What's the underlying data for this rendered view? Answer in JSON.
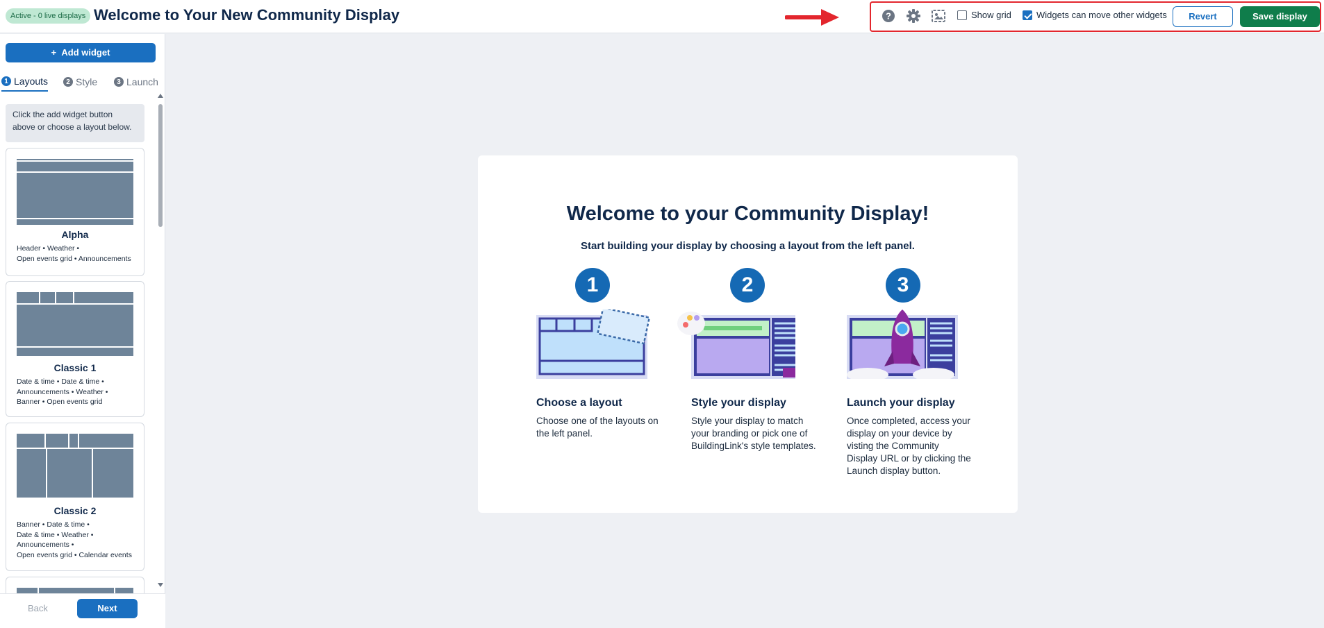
{
  "header": {
    "status_badge": "Active - 0 live displays",
    "title": "Welcome to Your New Community Display",
    "toolbar": {
      "help_icon": "question-circle-icon",
      "settings_icon": "gear-icon",
      "preview_icon": "fullscreen-preview-icon",
      "show_grid_label": "Show grid",
      "show_grid_checked": false,
      "widgets_move_label": "Widgets can move other widgets",
      "widgets_move_checked": true,
      "revert_label": "Revert",
      "save_label": "Save display"
    }
  },
  "sidebar": {
    "add_widget_label": "Add widget",
    "tabs": [
      {
        "num": "1",
        "label": "Layouts",
        "active": true
      },
      {
        "num": "2",
        "label": "Style",
        "active": false
      },
      {
        "num": "3",
        "label": "Launch",
        "active": false
      }
    ],
    "hint": "Click the add widget button above or choose a layout below.",
    "layouts": [
      {
        "name": "Alpha",
        "desc": "Header • Weather •\nOpen events grid • Announcements"
      },
      {
        "name": "Classic 1",
        "desc": "Date & time • Date & time •\nAnnouncements • Weather •\nBanner • Open events grid"
      },
      {
        "name": "Classic 2",
        "desc": "Banner • Date & time •\nDate & time • Weather •\nAnnouncements •\nOpen events grid • Calendar events"
      }
    ],
    "footer": {
      "back_label": "Back",
      "next_label": "Next"
    }
  },
  "welcome": {
    "title": "Welcome to your Community Display!",
    "subtitle": "Start building your display by choosing a layout from the left panel.",
    "steps": [
      {
        "num": "1",
        "title": "Choose a layout",
        "text": "Choose one of the layouts on the left panel."
      },
      {
        "num": "2",
        "title": "Style your display",
        "text": "Style your display to match your branding or pick one of BuildingLink's style templates."
      },
      {
        "num": "3",
        "title": "Launch your display",
        "text": "Once completed, access your display on your device by visting the Community Display URL or by clicking the Launch display button."
      }
    ]
  },
  "colors": {
    "primary": "#1a6fc0",
    "save": "#0f7d4b",
    "highlight_frame": "#e3262d",
    "badge_bg": "#bfe8d3"
  }
}
